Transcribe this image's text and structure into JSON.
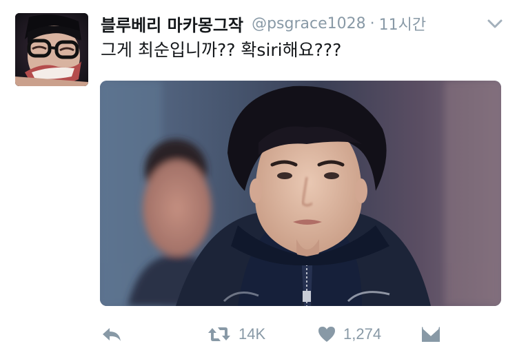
{
  "tweet": {
    "display_name": "블루베리 마카몽그작",
    "handle": "@psgrace1028",
    "separator": "·",
    "time": "11시간",
    "text": "그게 최순입니까?? 확siri해요???"
  },
  "actions": {
    "retweet_count": "14K",
    "like_count": "1,274"
  },
  "icons": {
    "caret": "chevron-down-icon",
    "reply": "reply-icon",
    "retweet": "retweet-icon",
    "like": "heart-icon",
    "dm": "envelope-icon"
  },
  "colors": {
    "text": "#14171a",
    "secondary": "#8899a6"
  }
}
